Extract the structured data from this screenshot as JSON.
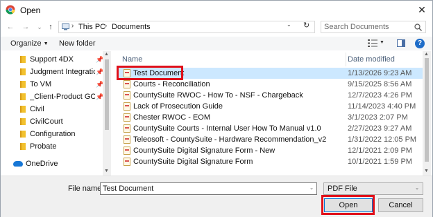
{
  "window": {
    "title": "Open",
    "close_glyph": "✕"
  },
  "address": {
    "back_glyph": "←",
    "forward_glyph": "→",
    "history_glyph": "⌄",
    "up_glyph": "↑",
    "crumbs": [
      "This PC",
      "Documents"
    ],
    "sep_glyph": "›",
    "dropdown_glyph": "⌄",
    "refresh_glyph": "↻",
    "search_placeholder": "Search Documents"
  },
  "toolbar": {
    "organize_label": "Organize",
    "arrow_glyph": "▼",
    "new_folder_label": "New folder"
  },
  "nav": {
    "pin_glyph": "📌",
    "items": [
      {
        "label": "Support 4DX",
        "pinned": true
      },
      {
        "label": "Judgment Integration T",
        "pinned": true
      },
      {
        "label": "To VM",
        "pinned": true
      },
      {
        "label": "_Client-Product GOLD S",
        "pinned": true
      },
      {
        "label": "Civil",
        "pinned": false
      },
      {
        "label": "CivilCourt",
        "pinned": false
      },
      {
        "label": "Configuration",
        "pinned": false
      },
      {
        "label": "Probate",
        "pinned": false
      }
    ],
    "onedrive_label": "OneDrive",
    "scroll_up_glyph": "▲",
    "scroll_down_glyph": "▼"
  },
  "list": {
    "columns": {
      "name": "Name",
      "date": "Date modified"
    },
    "files": [
      {
        "name": "Test Document",
        "date": "1/13/2026 9:23 AM",
        "selected": true
      },
      {
        "name": "Courts - Reconciliation",
        "date": "9/15/2025 8:56 AM"
      },
      {
        "name": "CountySuite RWOC - How To - NSF - Chargeback",
        "date": "12/7/2023 4:26 PM"
      },
      {
        "name": "Lack of Prosecution Guide",
        "date": "11/14/2023 4:40 PM"
      },
      {
        "name": "Chester RWOC - EOM",
        "date": "3/1/2023 2:07 PM"
      },
      {
        "name": "CountySuite Courts - Internal User How To Manual v1.0",
        "date": "2/27/2023 9:27 AM"
      },
      {
        "name": "Teleosoft - CountySuite - Hardware Recommendation_v2",
        "date": "1/31/2022 12:05 PM"
      },
      {
        "name": "CountySuite Digital Signature Form - New",
        "date": "12/1/2021 2:09 PM"
      },
      {
        "name": "CountySuite Digital Signature Form",
        "date": "10/1/2021 1:59 PM"
      }
    ]
  },
  "bottom": {
    "file_name_label": "File name:",
    "file_name_value": "Test Document",
    "file_type": "PDF File",
    "dropdown_glyph": "⌄",
    "open_label": "Open",
    "cancel_label": "Cancel"
  },
  "colors": {
    "selection": "#cce8ff",
    "highlight": "#e0101a",
    "folder": "#f2c12e",
    "accent": "#0078d7"
  }
}
